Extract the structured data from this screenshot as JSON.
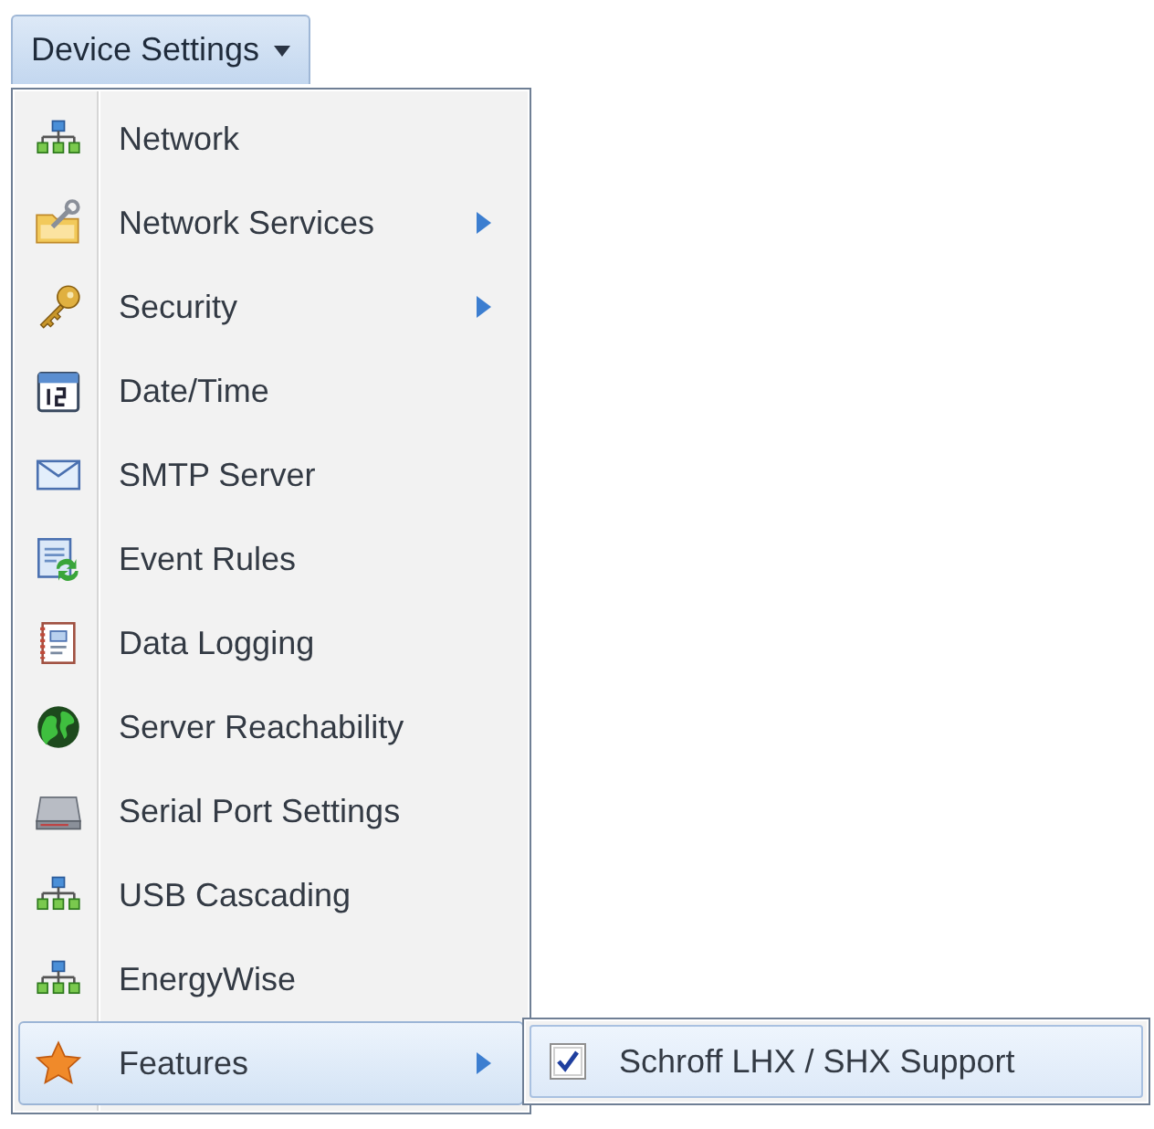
{
  "dropdown_button": {
    "label": "Device Settings",
    "expanded": true
  },
  "menu": {
    "items": [
      {
        "label": "Network",
        "has_submenu": false,
        "selected": false
      },
      {
        "label": "Network Services",
        "has_submenu": true,
        "selected": false
      },
      {
        "label": "Security",
        "has_submenu": true,
        "selected": false
      },
      {
        "label": "Date/Time",
        "has_submenu": false,
        "selected": false
      },
      {
        "label": "SMTP Server",
        "has_submenu": false,
        "selected": false
      },
      {
        "label": "Event Rules",
        "has_submenu": false,
        "selected": false
      },
      {
        "label": "Data Logging",
        "has_submenu": false,
        "selected": false
      },
      {
        "label": "Server Reachability",
        "has_submenu": false,
        "selected": false
      },
      {
        "label": "Serial Port Settings",
        "has_submenu": false,
        "selected": false
      },
      {
        "label": "USB Cascading",
        "has_submenu": false,
        "selected": false
      },
      {
        "label": "EnergyWise",
        "has_submenu": false,
        "selected": false
      },
      {
        "label": "Features",
        "has_submenu": true,
        "selected": true
      }
    ]
  },
  "submenu": {
    "items": [
      {
        "label": "Schroff LHX / SHX Support",
        "checked": true,
        "selected": true
      }
    ]
  }
}
